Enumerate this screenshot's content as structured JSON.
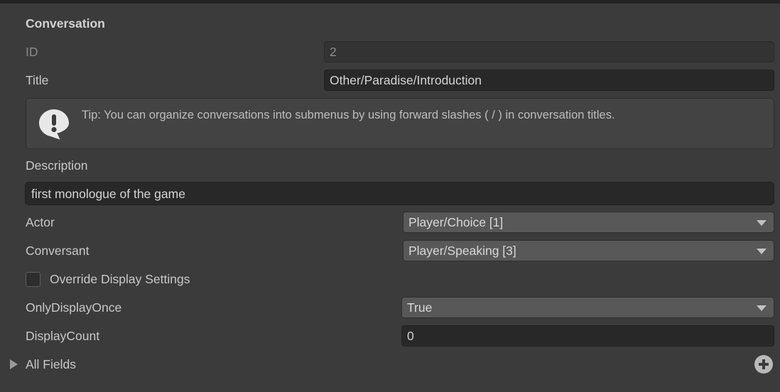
{
  "panel": {
    "header": "Conversation"
  },
  "fields": {
    "id": {
      "label": "ID",
      "value": "2",
      "disabled": true
    },
    "title": {
      "label": "Title",
      "value": "Other/Paradise/Introduction"
    },
    "description": {
      "label": "Description",
      "value": "first monologue of the game"
    },
    "actor": {
      "label": "Actor",
      "value": "Player/Choice [1]"
    },
    "conversant": {
      "label": "Conversant",
      "value": "Player/Speaking [3]"
    },
    "override_display_settings": {
      "label": "Override Display Settings",
      "checked": false
    },
    "only_display_once": {
      "label": "OnlyDisplayOnce",
      "value": "True"
    },
    "display_count": {
      "label": "DisplayCount",
      "value": "0"
    },
    "all_fields": {
      "label": "All Fields",
      "expanded": false
    }
  },
  "tip": {
    "icon": "info-speech-bubble-icon",
    "text": "Tip: You can organize conversations into submenus by using forward slashes ( / ) in conversation titles."
  },
  "buttons": {
    "add": "add-field-button"
  },
  "colors": {
    "background": "#383838",
    "panel": "#3b3b3b",
    "field_background": "#282828",
    "popup_background": "#585858",
    "help_background": "#434343",
    "text": "#c8c8c8",
    "text_dim": "#8a8a8a"
  }
}
